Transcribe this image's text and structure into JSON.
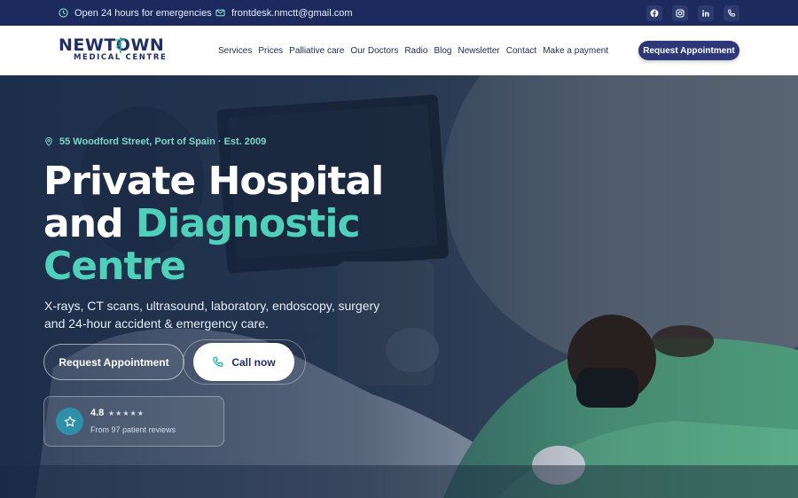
{
  "topbar": {
    "hours": "Open 24 hours for emergencies",
    "email": "frontdesk.nmctt@gmail.com",
    "socials": [
      "facebook-icon",
      "instagram-icon",
      "linkedin-icon",
      "phone-icon"
    ]
  },
  "brand": {
    "wordmark": "NEWTOWN",
    "subtitle": "MEDICAL CENTRE"
  },
  "nav": {
    "items": [
      "Services",
      "Prices",
      "Palliative care",
      "Our Doctors",
      "Radio",
      "Blog",
      "Newsletter",
      "Contact",
      "Make a payment"
    ],
    "cta": "Request Appointment"
  },
  "hero": {
    "address": "55 Woodford Street, Port of Spain · Est. 2009",
    "headline_line1": "Private Hospital",
    "headline_line2_a": "and ",
    "headline_line2_b": "Diagnostic",
    "headline_line3": "Centre",
    "lead": "X-rays, CT scans, ultrasound, laboratory, endoscopy, surgery and 24-hour accident & emergency care.",
    "btn_appointment": "Request Appointment",
    "btn_call": "Call now"
  },
  "rating": {
    "score": "4.8",
    "stars": "★★★★★",
    "note": "From 97 patient reviews"
  },
  "colors": {
    "topbar": "#1c2a5e",
    "accent": "#4fd0bb",
    "brand": "#1f2f66",
    "cta": "#2d3878"
  }
}
